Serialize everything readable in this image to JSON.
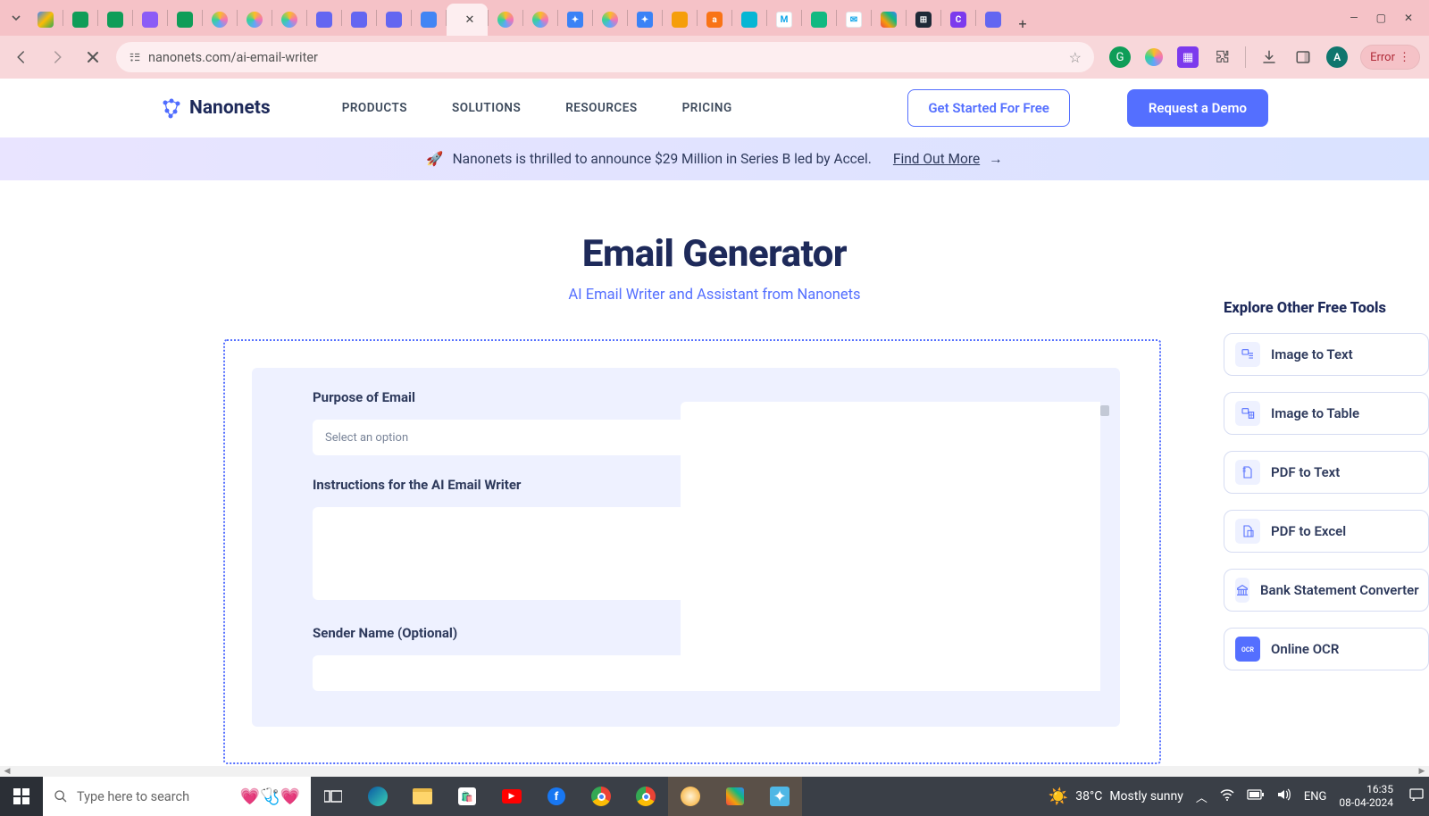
{
  "browser": {
    "url": "nanonets.com/ai-email-writer",
    "error_label": "Error",
    "avatar_letter": "A",
    "new_tab": "+",
    "window_controls": {
      "min": "—",
      "max": "▢",
      "close": "✕"
    }
  },
  "site": {
    "brand": "Nanonets",
    "nav": [
      "PRODUCTS",
      "SOLUTIONS",
      "RESOURCES",
      "PRICING"
    ],
    "cta_outline": "Get Started For Free",
    "cta_primary": "Request a Demo",
    "banner_emoji": "🚀",
    "banner_text": "Nanonets is thrilled to announce $29 Million in Series B led by Accel.",
    "banner_link": "Find Out More",
    "hero_title": "Email Generator",
    "hero_sub": "AI Email Writer and Assistant from Nanonets"
  },
  "form": {
    "purpose_label": "Purpose of Email",
    "purpose_placeholder": "Select an option",
    "instructions_label": "Instructions for the AI Email Writer",
    "sender_label": "Sender Name (Optional)"
  },
  "tools": {
    "heading": "Explore Other Free Tools",
    "items": [
      "Image to Text",
      "Image to Table",
      "PDF to Text",
      "PDF to Excel",
      "Bank Statement Converter",
      "Online OCR"
    ]
  },
  "taskbar": {
    "search_placeholder": "Type here to search",
    "weather_temp": "38°C",
    "weather_text": "Mostly sunny",
    "lang": "ENG",
    "time": "16:35",
    "date": "08-04-2024"
  }
}
